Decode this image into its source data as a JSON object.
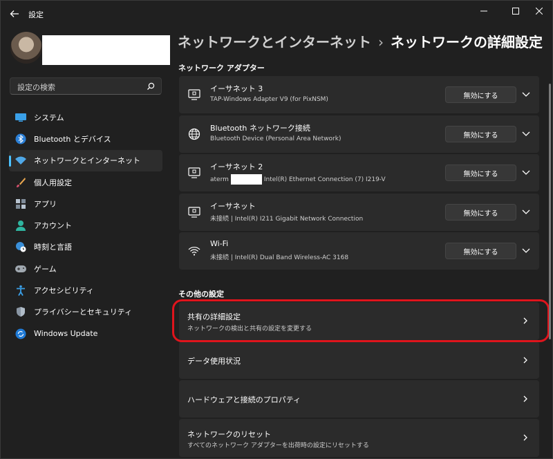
{
  "window": {
    "title": "設定"
  },
  "profile": {
    "name": ""
  },
  "search": {
    "placeholder": "設定の検索"
  },
  "nav": {
    "items": [
      {
        "label": "システム",
        "icon": "monitor-icon"
      },
      {
        "label": "Bluetooth とデバイス",
        "icon": "bluetooth-icon"
      },
      {
        "label": "ネットワークとインターネット",
        "icon": "wifi-icon",
        "active": true
      },
      {
        "label": "個人用設定",
        "icon": "brush-icon"
      },
      {
        "label": "アプリ",
        "icon": "apps-icon"
      },
      {
        "label": "アカウント",
        "icon": "account-icon"
      },
      {
        "label": "時刻と言語",
        "icon": "globe-clock-icon"
      },
      {
        "label": "ゲーム",
        "icon": "gamepad-icon"
      },
      {
        "label": "アクセシビリティ",
        "icon": "accessibility-icon"
      },
      {
        "label": "プライバシーとセキュリティ",
        "icon": "shield-icon"
      },
      {
        "label": "Windows Update",
        "icon": "windows-update-icon"
      }
    ]
  },
  "breadcrumb": {
    "parent": "ネットワークとインターネット",
    "separator": "›",
    "current": "ネットワークの詳細設定"
  },
  "adapters_section": {
    "title": "ネットワーク アダプター",
    "disable_label": "無効にする",
    "items": [
      {
        "name": "イーサネット 3",
        "desc": "TAP-Windows Adapter V9 (for PixNSM)",
        "icon": "ethernet-icon"
      },
      {
        "name": "Bluetooth ネットワーク接続",
        "desc": "Bluetooth Device (Personal Area Network)",
        "icon": "network-globe-icon"
      },
      {
        "name": "イーサネット 2",
        "desc_prefix": "aterm",
        "desc_suffix": "Intel(R) Ethernet Connection (7) I219-V",
        "icon": "ethernet-icon"
      },
      {
        "name": "イーサネット",
        "desc": "未接続 | Intel(R) I211 Gigabit Network Connection",
        "icon": "ethernet-icon"
      },
      {
        "name": "Wi-Fi",
        "desc": "未接続 | Intel(R) Dual Band Wireless-AC 3168",
        "icon": "wifi-icon"
      }
    ]
  },
  "other_section": {
    "title": "その他の設定",
    "items": [
      {
        "title": "共有の詳細設定",
        "desc": "ネットワークの検出と共有の設定を変更する"
      },
      {
        "title": "データ使用状況",
        "desc": ""
      },
      {
        "title": "ハードウェアと接続のプロパティ",
        "desc": ""
      },
      {
        "title": "ネットワークのリセット",
        "desc": "すべてのネットワーク アダプターを出荷時の設定にリセットする"
      }
    ]
  },
  "colors": {
    "accent": "#4cc2ff",
    "highlight": "#e0141c",
    "background": "#202020",
    "card": "#2b2b2b"
  }
}
